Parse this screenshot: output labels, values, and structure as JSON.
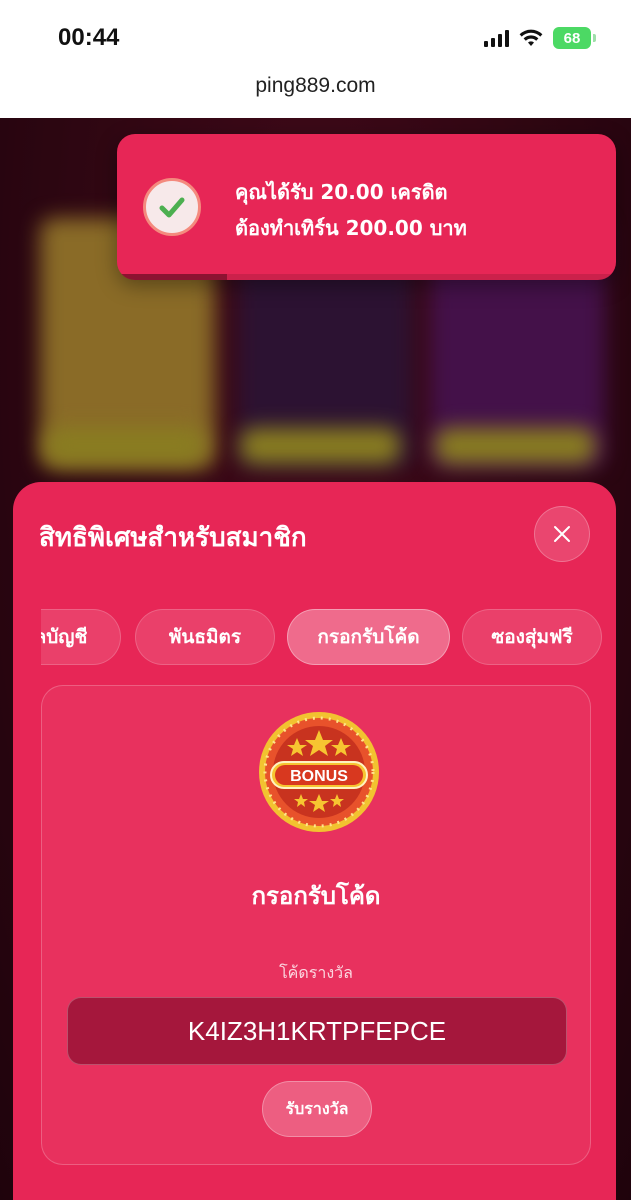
{
  "status_bar": {
    "time": "00:44",
    "battery": "68",
    "icons": [
      "signal-icon",
      "wifi-icon",
      "battery-icon"
    ]
  },
  "browser": {
    "url": "ping889.com"
  },
  "toast": {
    "line1": "คุณได้รับ 20.00 เครดิต",
    "line2": "ต้องทำเทิร์น 200.00 บาท",
    "icon": "check-circle-icon",
    "progress": 0.22
  },
  "modal": {
    "title": "สิทธิพิเศษสำหรับสมาชิก",
    "close_icon": "close-icon",
    "tabs": [
      {
        "label": "ลบัญชี"
      },
      {
        "label": "พันธมิตร"
      },
      {
        "label": "กรอกรับโค้ด",
        "active": true
      },
      {
        "label": "ซองสุ่มฟรี"
      }
    ],
    "card": {
      "badge_text": "BONUS",
      "title": "กรอกรับโค้ด",
      "code_label": "โค้ดรางวัล",
      "code_value": "K4IZ3H1KRTPFEPCE",
      "claim_label": "รับรางวัล"
    }
  },
  "colors": {
    "accent": "#e72656",
    "input_bg": "#a5173c",
    "check": "#4caf50",
    "battery": "#4cd964"
  }
}
